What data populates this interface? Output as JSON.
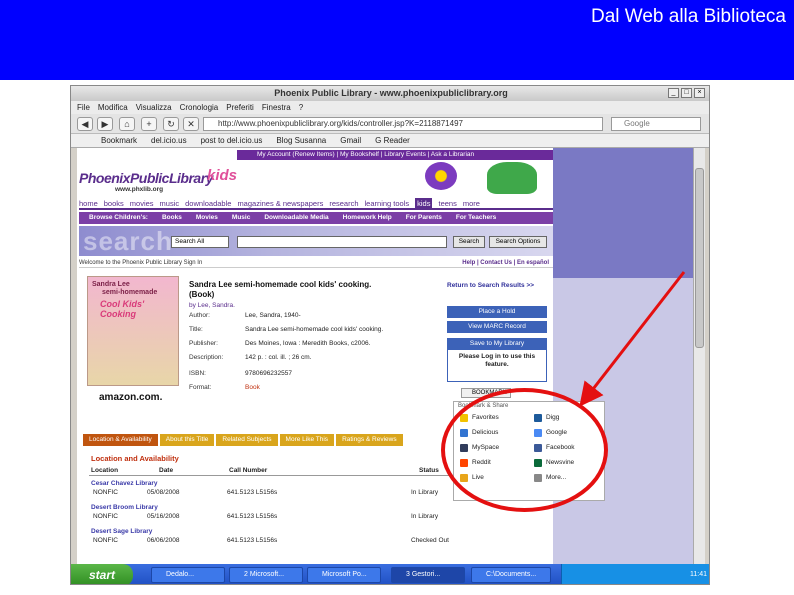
{
  "slide": {
    "title": "Dal Web alla Biblioteca"
  },
  "browser": {
    "window_title": "Phoenix Public Library - www.phoenixpubliclibrary.org",
    "menu": [
      "File",
      "Modifica",
      "Visualizza",
      "Cronologia",
      "Preferiti",
      "Finestra",
      "?"
    ],
    "url": "http://www.phoenixpubliclibrary.org/kids/controller.jsp?K=2118871497",
    "search_placeholder": "Google",
    "bookmarks": [
      "Bookmark",
      "del.icio.us",
      "post to del.icio.us",
      "Blog Susanna",
      "Gmail",
      "G Reader"
    ]
  },
  "site": {
    "top_links": "My Account (Renew Items)  |  My Bookshelf  |  Library Events  |  Ask a Librarian",
    "logo_main": "PhoenixPublicLibrary",
    "logo_kids": "kids",
    "logo_url": "www.phxlib.org",
    "nav_tabs": [
      "home",
      "books",
      "movies",
      "music",
      "downloadable",
      "magazines & newspapers",
      "research",
      "learning tools",
      "kids",
      "teens",
      "more"
    ],
    "sub_nav": [
      "Browse Children's:",
      "Books",
      "Movies",
      "Music",
      "Downloadable Media",
      "Homework Help",
      "For Parents",
      "For Teachers"
    ],
    "search_watermark": "search",
    "search_select": "Search All",
    "search_button": "Search",
    "search_options_button": "Search Options",
    "welcome": "Welcome to the Phoenix Public Library  Sign In",
    "welcome_right": "Help  |  Contact Us  |  En español"
  },
  "book": {
    "cover_author": "Sandra Lee",
    "cover_line2": "semi-homemade",
    "cover_title": "Cool Kids' Cooking",
    "vendor": "amazon.com.",
    "title": "Sandra Lee semi-homemade cool kids' cooking. (Book)",
    "by": "by Lee, Sandra.",
    "meta": [
      {
        "label": "Author:",
        "value": "Lee, Sandra, 1940-"
      },
      {
        "label": "Title:",
        "value": "Sandra Lee semi-homemade cool kids' cooking."
      },
      {
        "label": "Publisher:",
        "value": "Des Moines, Iowa : Meredith Books, c2006."
      },
      {
        "label": "Description:",
        "value": "142 p. : col. ill. ; 26 cm."
      },
      {
        "label": "ISBN:",
        "value": "9780696232557"
      },
      {
        "label": "Format:",
        "value": "Book"
      }
    ],
    "return_link": "Return to Search Results >>",
    "place_hold": "Place a Hold",
    "view_marc": "View MARC Record",
    "save_to": "Save to My Library",
    "login_note": "Please Log in to use this feature.",
    "bookmark_btn": "BOOKMARK"
  },
  "detail_tabs": [
    "Location & Availability",
    "About this Title",
    "Related Subjects",
    "More Like This",
    "Ratings & Reviews"
  ],
  "availability": {
    "heading": "Location and Availability",
    "columns": [
      "Location",
      "Date",
      "Call Number",
      "Status"
    ],
    "rows": [
      {
        "library": "Cesar Chavez Library",
        "collection": "NONFIC",
        "date": "05/08/2008",
        "call": "641.5123 L5156s",
        "status": "In Library"
      },
      {
        "library": "Desert Broom Library",
        "collection": "NONFIC",
        "date": "05/16/2008",
        "call": "641.5123 L5156s",
        "status": "In Library"
      },
      {
        "library": "Desert Sage Library",
        "collection": "NONFIC",
        "date": "06/06/2008",
        "call": "641.5123 L5156s",
        "status": "Checked Out"
      }
    ]
  },
  "share": {
    "header": "Bookmark & Share",
    "items": [
      {
        "label": "Favorites",
        "color": "#f2c200"
      },
      {
        "label": "Digg",
        "color": "#1d5a9a"
      },
      {
        "label": "Delicious",
        "color": "#3274d1"
      },
      {
        "label": "Google",
        "color": "#4a8af4"
      },
      {
        "label": "MySpace",
        "color": "#313c5c"
      },
      {
        "label": "Facebook",
        "color": "#3b5998"
      },
      {
        "label": "Reddit",
        "color": "#ff4500"
      },
      {
        "label": "Newsvine",
        "color": "#0a6a3a"
      },
      {
        "label": "Live",
        "color": "#e8a51a"
      },
      {
        "label": "More...",
        "color": "#888888"
      }
    ]
  },
  "taskbar": {
    "start": "start",
    "tasks": [
      "Dedalo...",
      "2 Microsoft...",
      "Microsoft Po...",
      "3 Gestori...",
      "C:\\Documents..."
    ],
    "clock": "11:41"
  },
  "colors": {
    "slide_header": "#0000ff",
    "annotation": "#e41010",
    "site_purple": "#5a2d8c"
  }
}
